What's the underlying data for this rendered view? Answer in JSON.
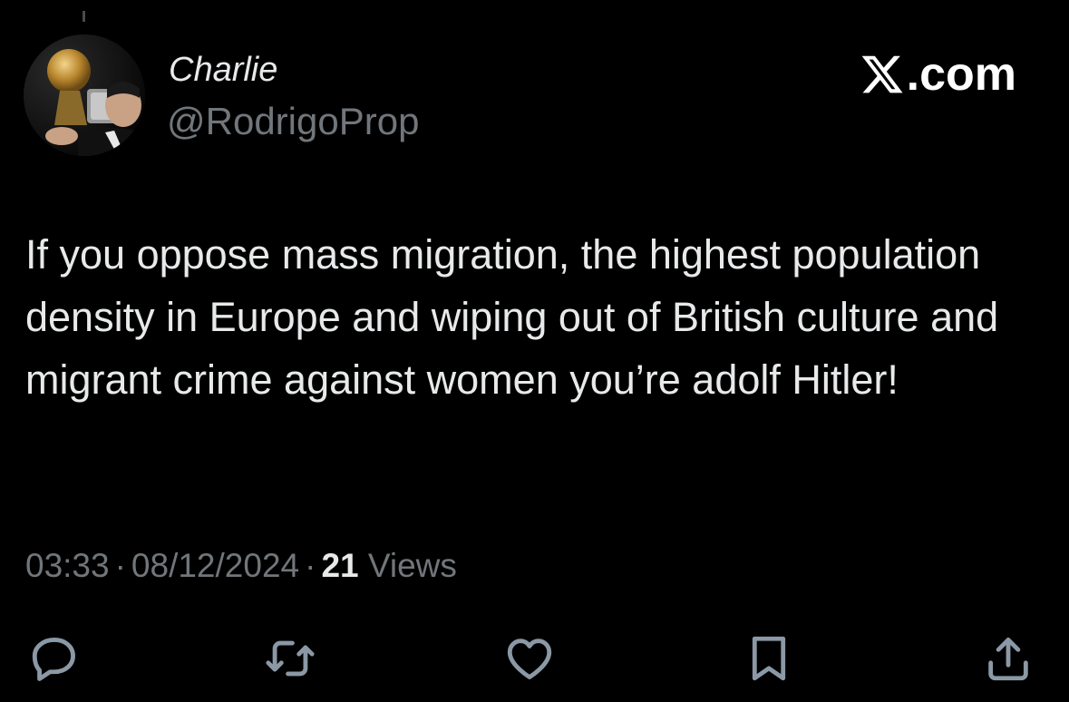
{
  "post": {
    "display_name": "Charlie",
    "handle": "@RodrigoProp",
    "avatar_icon": "profile-photo",
    "brand": ".com",
    "brand_icon": "x-logo-icon",
    "text": "If you oppose mass migration, the highest population density in Europe and wiping out of British culture and migrant crime against women you’re adolf Hitler!",
    "time": "03:33",
    "date": "08/12/2024",
    "views_count": "21",
    "views_label": "Views",
    "separator": "·"
  },
  "actions": [
    {
      "icon": "reply-icon"
    },
    {
      "icon": "repost-icon"
    },
    {
      "icon": "like-icon"
    },
    {
      "icon": "bookmark-icon"
    },
    {
      "icon": "share-icon"
    }
  ],
  "colors": {
    "background": "#000000",
    "primary_text": "#e7e9ea",
    "secondary_text": "#71767b"
  }
}
